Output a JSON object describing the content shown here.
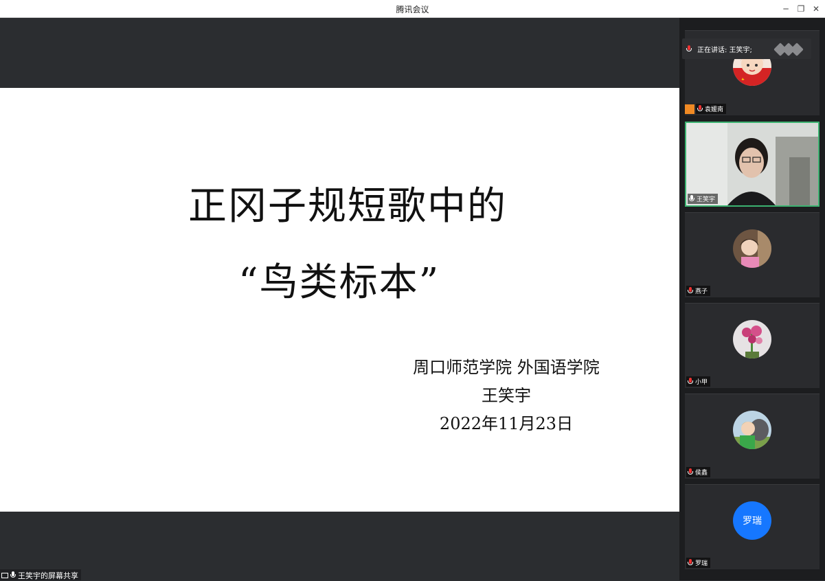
{
  "window": {
    "title": "腾讯会议",
    "minimize_label": "─",
    "restore_label": "❐",
    "close_label": "✕"
  },
  "slide": {
    "title_line1": "正冈子规短歌中的",
    "title_line2": "“鸟类标本”",
    "affiliation": "周口师范学院  外国语学院",
    "author": "王笑宇",
    "date": "2022年11月23日"
  },
  "share_tag": {
    "label": "王笑宇的屏幕共享"
  },
  "sidebar": {
    "speaking_label": "正在讲话: 王笑宇;",
    "participants": [
      {
        "name": "袁媛南",
        "mic": "off",
        "avatar": "cartoon-avatar",
        "host": true
      },
      {
        "name": "王笑宇",
        "mic": "on",
        "avatar": "camera-video",
        "active": true
      },
      {
        "name": "燕子",
        "mic": "off",
        "avatar": "photo-avatar"
      },
      {
        "name": "小甲",
        "mic": "off",
        "avatar": "flower-avatar"
      },
      {
        "name": "侯鑫",
        "mic": "off",
        "avatar": "child-dog-avatar"
      },
      {
        "name": "罗瑞",
        "mic": "off",
        "avatar": "initials-avatar",
        "initials": "罗瑞",
        "avatar_color": "#1677ff"
      }
    ]
  }
}
